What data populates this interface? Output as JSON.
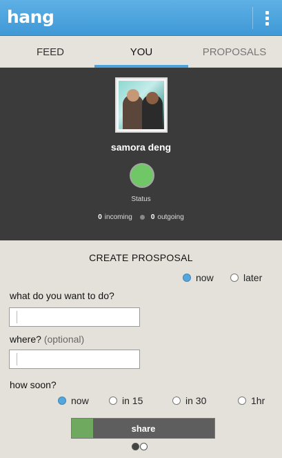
{
  "app": {
    "title": "hang"
  },
  "tabs": [
    "FEED",
    "YOU",
    "PROPOSALS"
  ],
  "active_tab": "YOU",
  "profile": {
    "name": "samora deng",
    "status_label": "Status",
    "status_color": "#6fc765",
    "incoming_count": "0",
    "incoming_label": "incoming",
    "outgoing_count": "0",
    "outgoing_label": "outgoing"
  },
  "form": {
    "title": "CREATE PROSPOSAL",
    "timing": {
      "options": [
        "now",
        "later"
      ],
      "selected": "now"
    },
    "what_label": "what do you want to do?",
    "what_value": "",
    "where_label": "where?",
    "where_optional": "(optional)",
    "where_value": "",
    "how_soon_label": "how soon?",
    "how_soon": {
      "options": [
        "now",
        "in 15",
        "in 30",
        "1hr"
      ],
      "selected": "now"
    },
    "share_label": "share",
    "share_progress": 0.15
  },
  "pager": {
    "current": 1,
    "total": 2
  },
  "colors": {
    "accent": "#4fa3db",
    "appbar": "#3f99d6",
    "profile_bg": "#3b3b3b"
  },
  "icons": {
    "menu": "overflow-menu-icon"
  }
}
